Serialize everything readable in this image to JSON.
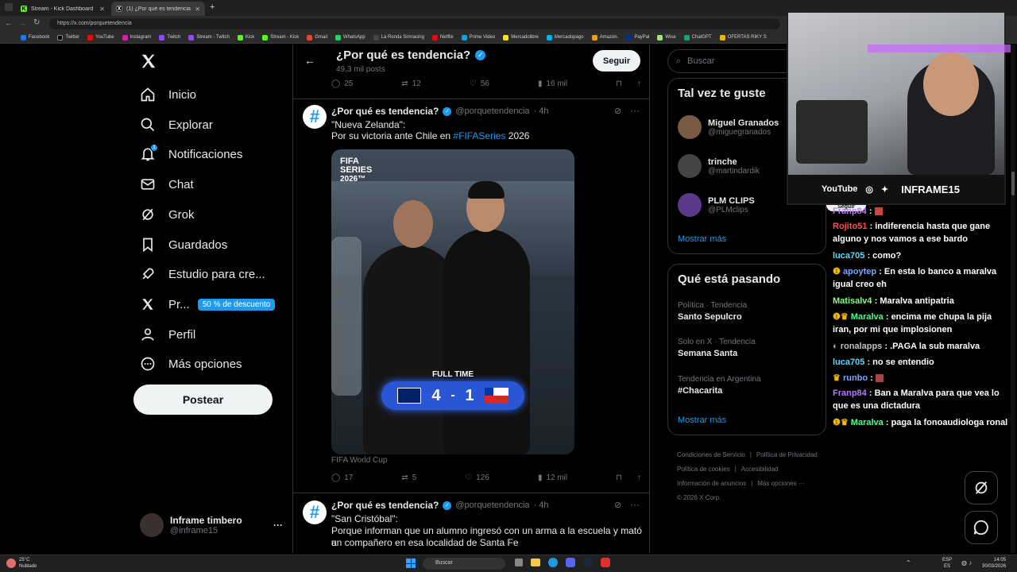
{
  "browser": {
    "tabs": [
      {
        "title": "Stream - Kick Dashboard",
        "icon": "kick-icon"
      },
      {
        "title": "(1) ¿Por qué es tendencia? (@porq",
        "icon": "x-icon"
      }
    ],
    "new_tab": "+",
    "url": "https://x.com/porquetendencia",
    "bookmarks": [
      "Facebook",
      "Twitter",
      "YouTube",
      "Instagram",
      "Twitch",
      "Stream - Twitch",
      "Kick",
      "Stream - Kick",
      "Gmail",
      "WhatsApp",
      "La Ronda Simracing",
      "Netflix",
      "Prime Video",
      "Mercadolibre",
      "Mercadopago",
      "Amazon.",
      "PayPal",
      "Wise",
      "ChatGPT",
      "OFERTAS RIKY S"
    ]
  },
  "nav": {
    "items": [
      "Inicio",
      "Explorar",
      "Notificaciones",
      "Chat",
      "Grok",
      "Guardados",
      "Estudio para cre...",
      "Pr...",
      "Perfil",
      "Más opciones"
    ],
    "notif_count": "1",
    "premium_badge": "50 % de descuento",
    "post_button": "Postear",
    "account_name": "Inframe timbero",
    "account_handle": "@inframe15",
    "more": "···"
  },
  "header": {
    "title": "¿Por qué es tendencia?",
    "posts": "49,3 mil posts",
    "follow": "Seguir"
  },
  "top_actions": {
    "replies": "25",
    "reposts": "12",
    "likes": "56",
    "views": "16 mil"
  },
  "tweet1": {
    "name": "¿Por qué es tendencia?",
    "handle": "@porquetendencia",
    "time": "· 4h",
    "line1": "\"Nueva Zelanda\":",
    "line2_pre": "Por su victoria ante Chile en ",
    "hashtag": "#FIFASeries",
    "line2_post": " 2026",
    "media_brand_1": "FIFA",
    "media_brand_2": "SERIES",
    "media_brand_3": "2026™",
    "fulltime": "FULL TIME",
    "score_home": "4",
    "score_dash": "-",
    "score_away": "1",
    "caption": "FIFA World Cup",
    "replies": "17",
    "reposts": "5",
    "likes": "126",
    "views": "12 mil"
  },
  "tweet2": {
    "name": "¿Por qué es tendencia?",
    "handle": "@porquetendencia",
    "time": "· 4h",
    "line1": "\"San Cristóbal\":",
    "line2": "Porque informan que un alumno ingresó con un arma a la escuela y mató a",
    "line3": "un compañero en esa localidad de Santa Fe"
  },
  "right": {
    "search_placeholder": "Buscar",
    "suggest_title": "Tal vez te guste",
    "suggestions": [
      {
        "name": "Miguel Granados",
        "handle": "@miguegranados"
      },
      {
        "name": "trinche",
        "handle": "@martindardik"
      },
      {
        "name": "PLM CLIPS",
        "handle": "@PLMclips"
      }
    ],
    "show_more": "Mostrar más",
    "happening_title": "Qué está pasando",
    "trends": [
      {
        "context": "Política · Tendencia",
        "name": "Santo Sepulcro"
      },
      {
        "context": "Solo en X · Tendencia",
        "name": "Semana Santa"
      },
      {
        "context": "Tendencia en Argentina",
        "name": "#Chacarita"
      }
    ],
    "show_more_2": "Mostrar más",
    "footer": [
      "Condiciones de Servicio",
      "|",
      "Política de Privacidad",
      "|",
      "Política de cookies",
      "|",
      "Accesibilidad",
      "|",
      "Información de anuncios",
      "|",
      "Más opciones ···",
      "© 2026 X Corp."
    ]
  },
  "overlay": {
    "youtube": "YouTube",
    "channel": "INFRAME15",
    "behind_label": "Seguir"
  },
  "chat": [
    {
      "user": "Franp84",
      "msg": ":",
      "color": "#b57cff"
    },
    {
      "user": "Rojito51",
      "msg": ": indiferencia hasta que gane alguno y nos vamos a ese bardo",
      "color": "#ff4d4d"
    },
    {
      "user": "luca705",
      "msg": ": como?",
      "color": "#5fd7ff"
    },
    {
      "user": "apoytep",
      "msg": ": En esta lo banco a maralva igual creo eh",
      "color": "#7aa7ff"
    },
    {
      "user": "Matisalv4",
      "msg": ": Maralva antipatria",
      "color": "#7fff7f"
    },
    {
      "user": "Maralva",
      "msg": ": encima me chupa la pija iran, por mi que implosionen",
      "color": "#4dff88"
    },
    {
      "user": "ronalapps",
      "msg": ": .PAGA la sub maralva",
      "color": "#c0c0c0"
    },
    {
      "user": "luca705",
      "msg": ": no se entendio",
      "color": "#5fd7ff"
    },
    {
      "user": "runbo",
      "msg": ":",
      "color": "#7aa7ff"
    },
    {
      "user": "Franp84",
      "msg": ": Ban a Maralva para que vea lo que es una dictadura",
      "color": "#b57cff"
    },
    {
      "user": "Maralva",
      "msg": ": paga la fonoaudiologa ronal",
      "color": "#4dff88"
    }
  ],
  "taskbar": {
    "weather_temp": "25°C",
    "weather_desc": "Nublado",
    "search": "Buscar",
    "lang1": "ESP",
    "lang2": "ES",
    "time": "14:05",
    "date": "30/03/2026"
  },
  "colors": {
    "accent": "#1d9bf0",
    "bg": "#000000",
    "border": "#2f3336",
    "muted": "#71767b"
  }
}
